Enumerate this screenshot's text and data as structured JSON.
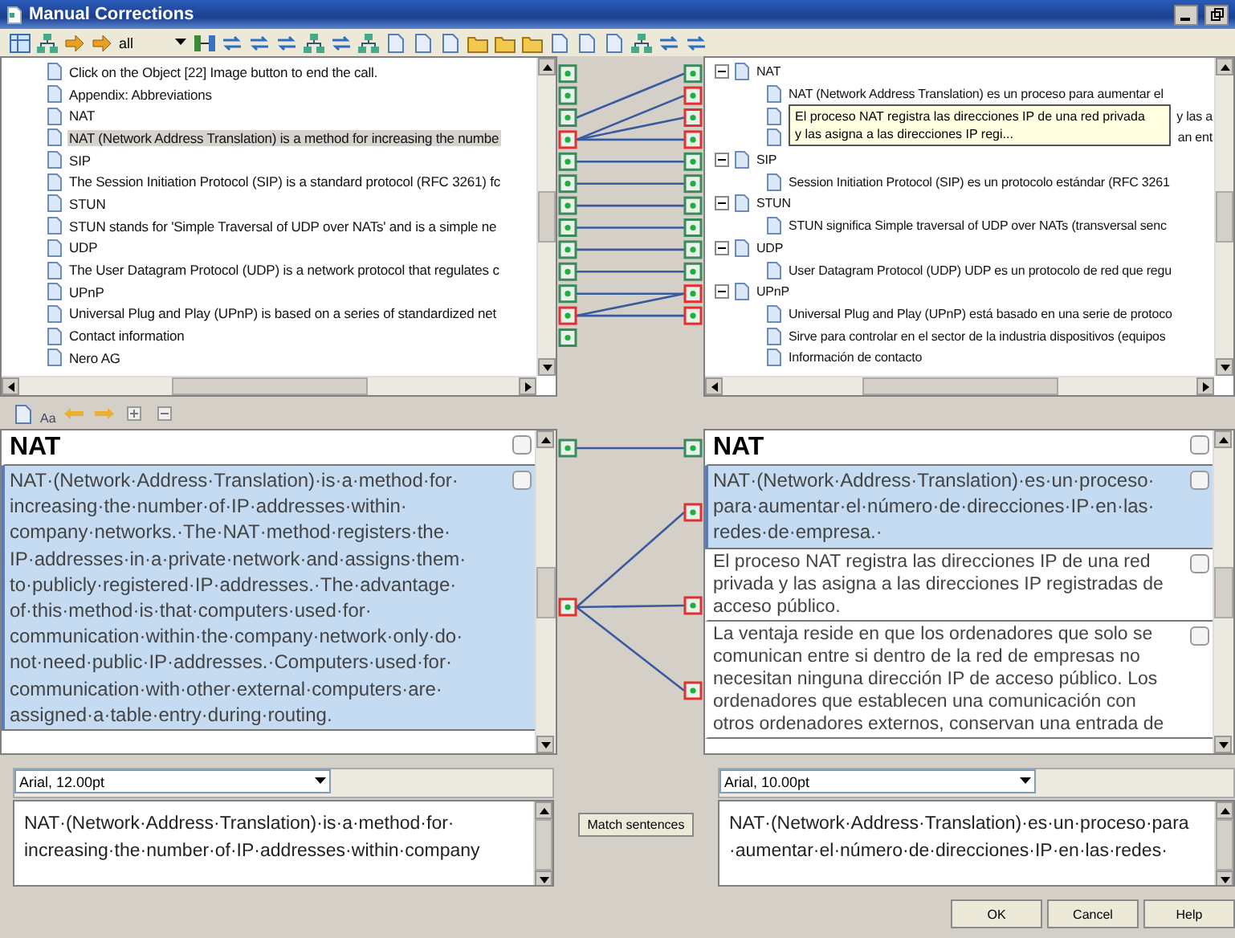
{
  "window": {
    "title": "Manual Corrections"
  },
  "toolbar": {
    "filter": "all"
  },
  "source_tree": {
    "items": [
      {
        "label": "Click on the Object [22] Image button to end the call.",
        "selected": false
      },
      {
        "label": "Appendix: Abbreviations",
        "selected": false
      },
      {
        "label": "NAT",
        "selected": false
      },
      {
        "label": "NAT (Network Address Translation) is a method for increasing the numbe",
        "selected": true
      },
      {
        "label": "SIP",
        "selected": false
      },
      {
        "label": "The Session Initiation Protocol (SIP) is a standard protocol (RFC 3261) fc",
        "selected": false
      },
      {
        "label": "STUN",
        "selected": false
      },
      {
        "label": "STUN stands for 'Simple Traversal of UDP over NATs' and is a simple ne",
        "selected": false
      },
      {
        "label": "UDP",
        "selected": false
      },
      {
        "label": "The User Datagram Protocol (UDP) is a network protocol that regulates c",
        "selected": false
      },
      {
        "label": "UPnP",
        "selected": false
      },
      {
        "label": "Universal Plug and Play (UPnP) is based on a series of standardized net",
        "selected": false
      },
      {
        "label": "Contact information",
        "selected": false
      },
      {
        "label": "Nero AG",
        "selected": false
      }
    ]
  },
  "tree_links": {
    "source": [
      {
        "flagged": false
      },
      {
        "flagged": false
      },
      {
        "flagged": false
      },
      {
        "flagged": true
      },
      {
        "flagged": false
      },
      {
        "flagged": false
      },
      {
        "flagged": false
      },
      {
        "flagged": false
      },
      {
        "flagged": false
      },
      {
        "flagged": false
      },
      {
        "flagged": false
      },
      {
        "flagged": true
      },
      {
        "flagged": false
      }
    ],
    "target": [
      {
        "flagged": false
      },
      {
        "flagged": true
      },
      {
        "flagged": true
      },
      {
        "flagged": true
      },
      {
        "flagged": false
      },
      {
        "flagged": false
      },
      {
        "flagged": false
      },
      {
        "flagged": false
      },
      {
        "flagged": false
      },
      {
        "flagged": false
      },
      {
        "flagged": true
      },
      {
        "flagged": true
      }
    ]
  },
  "target_tree": {
    "items": [
      {
        "label": "NAT",
        "expanded": true,
        "children": [
          {
            "label": "NAT (Network Address Translation) es un proceso para aumentar el",
            "covered": false
          },
          {
            "label": "y las a",
            "covered": true
          },
          {
            "label": "an ent",
            "covered": true
          }
        ]
      },
      {
        "label": "SIP",
        "expanded": true,
        "children": [
          {
            "label": "Session Initiation Protocol (SIP) es un protocolo estándar (RFC 3261",
            "covered": false
          }
        ]
      },
      {
        "label": "STUN",
        "expanded": true,
        "children": [
          {
            "label": "STUN significa Simple traversal of UDP over NATs (transversal senc",
            "covered": false
          }
        ]
      },
      {
        "label": "UDP",
        "expanded": true,
        "children": [
          {
            "label": "User Datagram Protocol (UDP) UDP es un protocolo de red que regu",
            "covered": false
          }
        ]
      },
      {
        "label": "UPnP",
        "expanded": true,
        "children": [
          {
            "label": "Universal Plug and Play (UPnP) está basado en una serie de protoco",
            "covered": false
          },
          {
            "label": "Sirve para controlar en el sector de la industria dispositivos (equipos",
            "covered": false
          },
          {
            "label": "Información de contacto",
            "covered": false
          }
        ]
      }
    ]
  },
  "tooltip": {
    "lines": [
      "El proceso NAT registra las direcciones IP de una red privada",
      "y las asigna a las direcciones IP regi..."
    ]
  },
  "editor_toolbar": {
    "font_button": "Aa"
  },
  "source_segments": [
    {
      "kind": "heading",
      "lines": [
        "NAT"
      ],
      "selected": false,
      "checked": false
    },
    {
      "kind": "paragraph",
      "selected": true,
      "checked": false,
      "lines": [
        "NAT·(Network·Address·Translation)·is·a·method·for·",
        "increasing·the·number·of·IP·addresses·within·",
        "company·networks.·The·NAT·method·registers·the·",
        "IP·addresses·in·a·private·network·and·assigns·them·",
        "to·publicly·registered·IP·addresses.·The·advantage·",
        "of·this·method·is·that·computers·used·for·",
        "communication·within·the·company·network·only·do·",
        "not·need·public·IP·addresses.·Computers·used·for·",
        "communication·with·other·external·computers·are·",
        "assigned·a·table·entry·during·routing."
      ]
    }
  ],
  "segment_links": {
    "source": [
      {
        "flagged": false
      },
      {
        "flagged": true
      }
    ],
    "target": [
      {
        "flagged": false
      },
      {
        "flagged": true
      },
      {
        "flagged": true
      },
      {
        "flagged": true
      }
    ]
  },
  "target_segments": [
    {
      "kind": "heading",
      "lines": [
        "NAT"
      ],
      "selected": false,
      "checked": false
    },
    {
      "kind": "paragraph",
      "selected": true,
      "checked": false,
      "lines": [
        "NAT·(Network·Address·Translation)·es·un·proceso·",
        "para·aumentar·el·número·de·direcciones·IP·en·las·",
        "redes·de·empresa.·"
      ]
    },
    {
      "kind": "paragraph",
      "selected": false,
      "checked": false,
      "lines": [
        "El proceso NAT registra las direcciones IP de una red",
        "privada y las asigna a las direcciones IP registradas de",
        "acceso público."
      ]
    },
    {
      "kind": "paragraph",
      "selected": false,
      "checked": false,
      "lines": [
        "La ventaja reside en que los ordenadores que solo se",
        "comunican entre si dentro de la red de empresas no",
        "necesitan ninguna dirección IP de acceso público. Los",
        "ordenadores que establecen una comunicación con",
        "otros ordenadores externos, conservan una entrada de"
      ]
    }
  ],
  "source_editor": {
    "font": "Arial, 12.00pt",
    "lines": [
      "NAT·(Network·Address·Translation)·is·a·method·for·",
      "increasing·the·number·of·IP·addresses·within·company"
    ]
  },
  "match_button": "Match sentences",
  "target_editor": {
    "font": "Arial, 10.00pt",
    "lines": [
      "NAT·(Network·Address·Translation)·es·un·proceso·para",
      "·aumentar·el·número·de·direcciones·IP·en·las·redes·"
    ]
  },
  "buttons": [
    "OK",
    "Cancel",
    "Help"
  ]
}
